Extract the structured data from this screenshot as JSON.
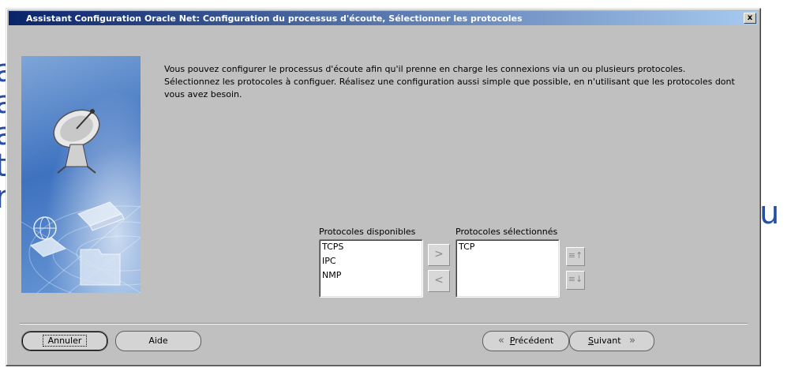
{
  "dialog": {
    "title": "Assistant Configuration Oracle Net: Configuration du processus d'écoute, Sélectionner les protocoles",
    "close_label": "x"
  },
  "intro": {
    "line1": "Vous pouvez configurer le processus d'écoute afin qu'il prenne en charge les connexions via un ou plusieurs protocoles.",
    "line2": "Sélectionnez les protocoles à configuer. Réalisez une configuration aussi simple que possible, en n'utilisant que les protocoles dont",
    "line3": "vous avez besoin."
  },
  "available": {
    "label": "Protocoles disponibles",
    "items": [
      "TCPS",
      "IPC",
      "NMP"
    ]
  },
  "selected": {
    "label": "Protocoles sélectionnés",
    "items": [
      "TCP"
    ]
  },
  "buttons": {
    "cancel": "Annuler",
    "help": "Aide",
    "previous_first": "P",
    "previous_rest": "récédent",
    "next_first": "S",
    "next_rest": "uivant"
  },
  "icons": {
    "move_right": "chevron-right-icon",
    "move_left": "chevron-left-icon",
    "move_up": "move-up-icon",
    "move_down": "move-down-icon",
    "previous": "double-chevron-left-icon",
    "next": "double-chevron-right-icon"
  },
  "colors": {
    "titlebar_start": "#0a246a",
    "titlebar_end": "#a6caf0",
    "dialog_bg": "#c0c0c0"
  }
}
